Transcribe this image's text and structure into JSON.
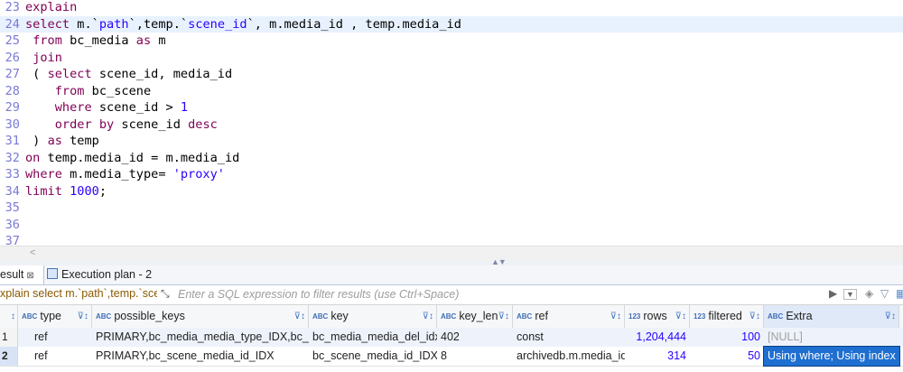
{
  "editor": {
    "lines": [
      {
        "n": "23",
        "tokens": [
          {
            "t": "explain",
            "c": "kw"
          }
        ]
      },
      {
        "n": "24",
        "current": true,
        "tokens": [
          {
            "t": "select",
            "c": "kw"
          },
          {
            "t": " m.`"
          },
          {
            "t": "path",
            "c": "str"
          },
          {
            "t": "`,temp.`"
          },
          {
            "t": "scene_id",
            "c": "str"
          },
          {
            "t": "`, m.media_id , temp.media_id"
          }
        ]
      },
      {
        "n": "25",
        "tokens": [
          {
            "t": " "
          },
          {
            "t": "from",
            "c": "kw"
          },
          {
            "t": " bc_media "
          },
          {
            "t": "as",
            "c": "kw"
          },
          {
            "t": " m"
          }
        ]
      },
      {
        "n": "26",
        "tokens": [
          {
            "t": " "
          },
          {
            "t": "join",
            "c": "kw"
          }
        ]
      },
      {
        "n": "27",
        "tokens": [
          {
            "t": " ( "
          },
          {
            "t": "select",
            "c": "kw"
          },
          {
            "t": " scene_id, media_id"
          }
        ]
      },
      {
        "n": "28",
        "tokens": [
          {
            "t": "    "
          },
          {
            "t": "from",
            "c": "kw"
          },
          {
            "t": " bc_scene"
          }
        ]
      },
      {
        "n": "29",
        "tokens": [
          {
            "t": "    "
          },
          {
            "t": "where",
            "c": "kw"
          },
          {
            "t": " scene_id > "
          },
          {
            "t": "1",
            "c": "num"
          }
        ]
      },
      {
        "n": "30",
        "tokens": [
          {
            "t": "    "
          },
          {
            "t": "order",
            "c": "kw"
          },
          {
            "t": " "
          },
          {
            "t": "by",
            "c": "kw"
          },
          {
            "t": " scene_id "
          },
          {
            "t": "desc",
            "c": "kw"
          }
        ]
      },
      {
        "n": "31",
        "tokens": [
          {
            "t": " ) "
          },
          {
            "t": "as",
            "c": "kw"
          },
          {
            "t": " temp"
          }
        ]
      },
      {
        "n": "32",
        "tokens": [
          {
            "t": "on",
            "c": "kw"
          },
          {
            "t": " temp.media_id = m.media_id"
          }
        ]
      },
      {
        "n": "33",
        "tokens": [
          {
            "t": "where",
            "c": "kw"
          },
          {
            "t": " m.media_type= "
          },
          {
            "t": "'proxy'",
            "c": "str"
          }
        ]
      },
      {
        "n": "34",
        "tokens": [
          {
            "t": "limit",
            "c": "kw"
          },
          {
            "t": " "
          },
          {
            "t": "1000",
            "c": "num"
          },
          {
            "t": ";"
          }
        ]
      },
      {
        "n": "35",
        "tokens": []
      },
      {
        "n": "36",
        "tokens": []
      },
      {
        "n": "37",
        "tokens": []
      }
    ]
  },
  "tabs": {
    "result_label": "esult",
    "exec_label": "Execution plan - 2"
  },
  "filter": {
    "query": "xplain select m.`path`,temp.`scer",
    "placeholder": "Enter a SQL expression to filter results (use Ctrl+Space)"
  },
  "grid": {
    "columns": [
      "type",
      "possible_keys",
      "key",
      "key_len",
      "ref",
      "rows",
      "filtered",
      "Extra"
    ],
    "type_badges": [
      "ABC",
      "ABC",
      "ABC",
      "ABC",
      "ABC",
      "123",
      "123",
      "ABC"
    ],
    "rows": [
      {
        "num": "1",
        "type": "ref",
        "possible_keys": "PRIMARY,bc_media_media_type_IDX,bc_mec",
        "key": "bc_media_media_del_idx",
        "key_len": "402",
        "ref": "const",
        "rows": "1,204,444",
        "filtered": "100",
        "extra": "[NULL]"
      },
      {
        "num": "2",
        "type": "ref",
        "possible_keys": "PRIMARY,bc_scene_media_id_IDX",
        "key": "bc_scene_media_id_IDX",
        "key_len": "8",
        "ref": "archivedb.m.media_id",
        "rows": "314",
        "filtered": "50",
        "extra": "Using where; Using index"
      }
    ]
  }
}
